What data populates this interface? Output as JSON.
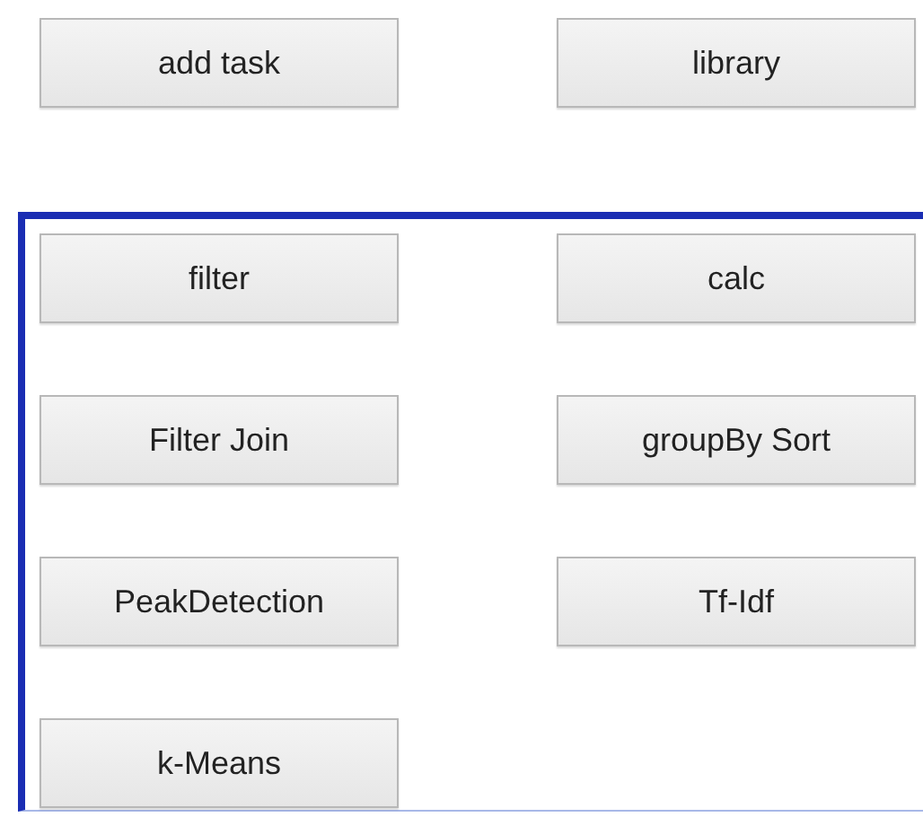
{
  "top_buttons": [
    "add task",
    "library"
  ],
  "task_panel": {
    "buttons": [
      "filter",
      "calc",
      "Filter Join",
      "groupBy Sort",
      "PeakDetection",
      "Tf-Idf",
      "k-Means"
    ]
  }
}
